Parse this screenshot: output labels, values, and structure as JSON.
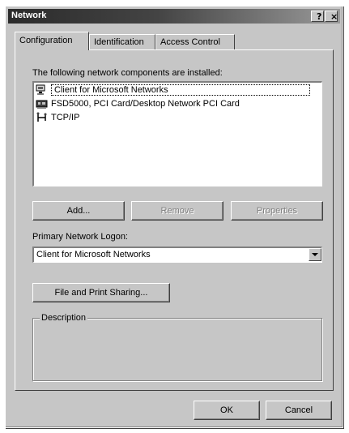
{
  "window": {
    "title": "Network",
    "help_glyph": "?",
    "close_glyph": "×"
  },
  "tabs": [
    {
      "label": "Configuration",
      "active": true
    },
    {
      "label": "Identification",
      "active": false
    },
    {
      "label": "Access Control",
      "active": false
    }
  ],
  "config": {
    "installed_label": "The following network components are installed:",
    "components": [
      {
        "label": "Client for Microsoft Networks",
        "icon": "network-client-icon",
        "selected": true
      },
      {
        "label": "FSD5000, PCI Card/Desktop Network PCI Card",
        "icon": "network-card-icon",
        "selected": false
      },
      {
        "label": "TCP/IP",
        "icon": "protocol-icon",
        "selected": false
      }
    ],
    "add_button": "Add...",
    "remove_button": "Remove",
    "properties_button": "Properties",
    "logon_label": "Primary Network Logon:",
    "logon_value": "Client for Microsoft Networks",
    "share_button": "File and Print Sharing...",
    "description_legend": "Description"
  },
  "footer": {
    "ok_button": "OK",
    "cancel_button": "Cancel"
  },
  "colors": {
    "face": "#c6c6c6",
    "title_start": "#2b2b2b",
    "title_end": "#9a9a9a"
  }
}
